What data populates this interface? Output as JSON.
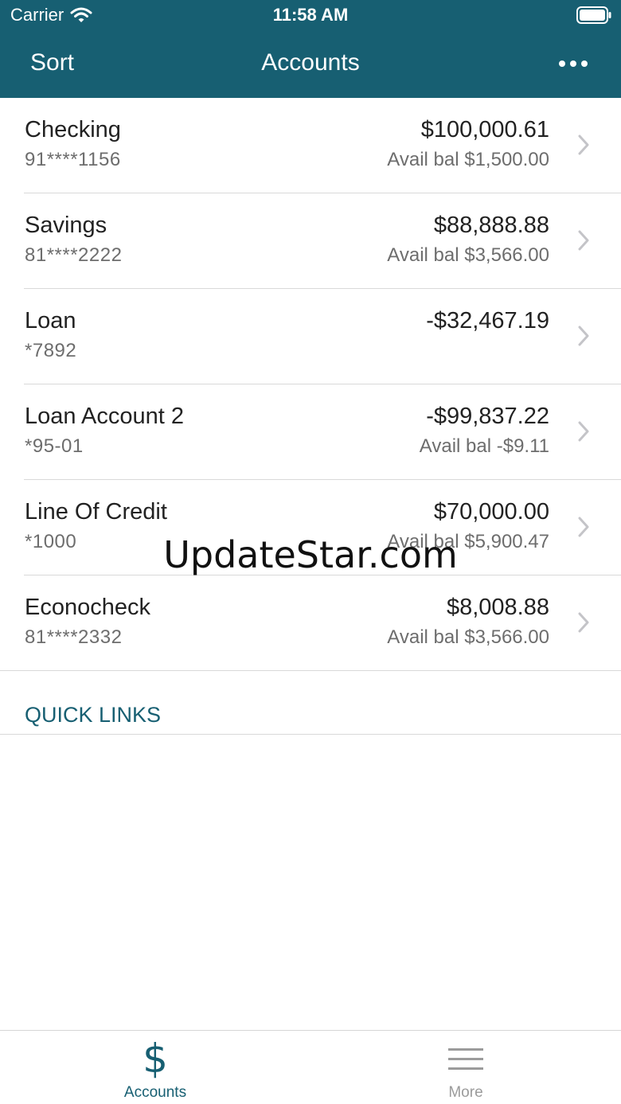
{
  "status_bar": {
    "carrier": "Carrier",
    "time": "11:58 AM"
  },
  "nav": {
    "sort_label": "Sort",
    "title": "Accounts"
  },
  "accounts": [
    {
      "name": "Checking",
      "number": "91****1156",
      "balance": "$100,000.61",
      "available": "Avail bal $1,500.00"
    },
    {
      "name": "Savings",
      "number": "81****2222",
      "balance": "$88,888.88",
      "available": "Avail bal $3,566.00"
    },
    {
      "name": "Loan",
      "number": "*7892",
      "balance": "-$32,467.19",
      "available": ""
    },
    {
      "name": "Loan Account 2",
      "number": "*95-01",
      "balance": "-$99,837.22",
      "available": "Avail bal -$9.11"
    },
    {
      "name": "Line Of Credit",
      "number": "*1000",
      "balance": "$70,000.00",
      "available": "Avail bal $5,900.47"
    },
    {
      "name": "Econocheck",
      "number": "81****2332",
      "balance": "$8,008.88",
      "available": "Avail bal $3,566.00"
    }
  ],
  "quick_links": {
    "label": "QUICK LINKS"
  },
  "watermark": "UpdateStar.com",
  "tabbar": {
    "accounts_label": "Accounts",
    "accounts_icon": "dollar-icon",
    "more_label": "More",
    "more_icon": "menu-icon"
  },
  "colors": {
    "brand": "#175f72",
    "divider": "#d9d9d9",
    "secondary_text": "#6d6d6d"
  }
}
